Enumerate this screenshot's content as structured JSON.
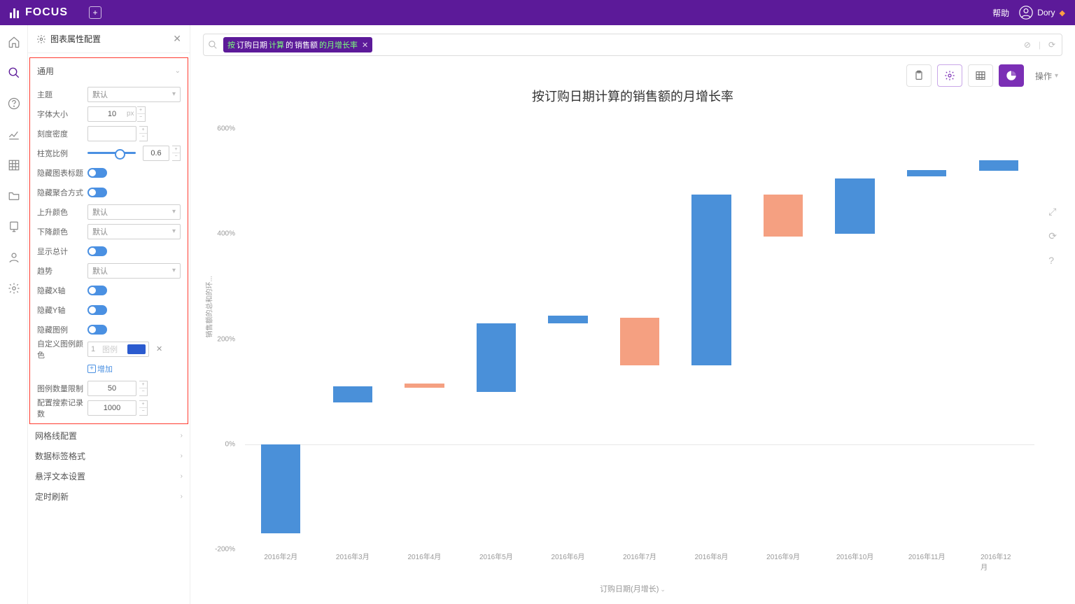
{
  "brand": "FOCUS",
  "help": "帮助",
  "user": "Dory",
  "panel": {
    "title": "图表属性配置",
    "section_general": "通用",
    "labels": {
      "theme": "主题",
      "font_size": "字体大小",
      "tick_density": "刻度密度",
      "bar_ratio": "柱宽比例",
      "hide_title": "隐藏图表标题",
      "hide_agg": "隐藏聚合方式",
      "up_color": "上升颜色",
      "down_color": "下降颜色",
      "show_total": "显示总计",
      "trend": "趋势",
      "hide_x": "隐藏X轴",
      "hide_y": "隐藏Y轴",
      "hide_legend": "隐藏图例",
      "custom_legend": "自定义图例颜色",
      "legend_limit": "图例数量限制",
      "search_limit": "配置搜索记录数",
      "add": "增加",
      "legend_ph": "图例"
    },
    "values": {
      "theme": "默认",
      "font_size": "10",
      "font_unit": "px",
      "tick_density": "",
      "bar_ratio": "0.6",
      "up_color": "默认",
      "down_color": "默认",
      "trend": "默认",
      "legend_idx": "1",
      "legend_limit": "50",
      "search_limit": "1000"
    },
    "sections": {
      "grid": "网格线配置",
      "datalabel": "数据标签格式",
      "tooltip": "悬浮文本设置",
      "refresh": "定时刷新"
    }
  },
  "search_chip": {
    "p1": "按",
    "p2": "订购日期",
    "p3": "计算",
    "p4": "的",
    "p5": "销售额",
    "p6": "的月增长率"
  },
  "toolbar": {
    "ops": "操作"
  },
  "chart_data": {
    "type": "bar",
    "title": "按订购日期计算的销售额的月增长率",
    "ylabel": "销售额的总和的环...",
    "xlabel": "订购日期(月增长)",
    "ylim_pct": [
      -200,
      600
    ],
    "yticks": [
      "600%",
      "400%",
      "200%",
      "0%",
      "-200%"
    ],
    "categories": [
      "2016年2月",
      "2016年3月",
      "2016年4月",
      "2016年5月",
      "2016年6月",
      "2016年7月",
      "2016年8月",
      "2016年9月",
      "2016年10月",
      "2016年11月",
      "2016年12月"
    ],
    "series": [
      {
        "name": "increase",
        "color": "#4a90d9"
      },
      {
        "name": "decrease",
        "color": "#f5a081"
      }
    ],
    "bars": [
      {
        "cat": "2016年2月",
        "from": 0,
        "to": -170,
        "dir": "down",
        "color": "blue"
      },
      {
        "cat": "2016年3月",
        "from": 80,
        "to": 110,
        "dir": "up",
        "color": "blue"
      },
      {
        "cat": "2016年4月",
        "from": 108,
        "to": 115,
        "dir": "up",
        "color": "orange"
      },
      {
        "cat": "2016年5月",
        "from": 100,
        "to": 230,
        "dir": "up",
        "color": "blue"
      },
      {
        "cat": "2016年6月",
        "from": 230,
        "to": 245,
        "dir": "up",
        "color": "blue"
      },
      {
        "cat": "2016年7月",
        "from": 150,
        "to": 240,
        "dir": "down",
        "color": "orange"
      },
      {
        "cat": "2016年8月",
        "from": 150,
        "to": 475,
        "dir": "up",
        "color": "blue"
      },
      {
        "cat": "2016年9月",
        "from": 395,
        "to": 475,
        "dir": "down",
        "color": "orange"
      },
      {
        "cat": "2016年10月",
        "from": 400,
        "to": 505,
        "dir": "up",
        "color": "blue"
      },
      {
        "cat": "2016年11月",
        "from": 510,
        "to": 522,
        "dir": "up",
        "color": "blue"
      },
      {
        "cat": "2016年12月",
        "from": 520,
        "to": 540,
        "dir": "up",
        "color": "blue"
      }
    ]
  }
}
